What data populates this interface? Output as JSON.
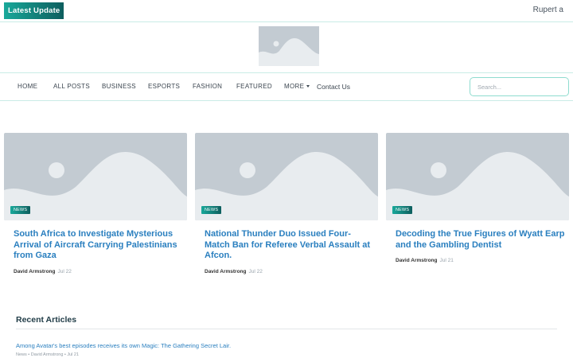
{
  "topbar": {
    "latest_label": "Latest  Update",
    "user_name": "Rupert a"
  },
  "nav": {
    "items": [
      "HOME",
      "ALL POSTS",
      "BUSINESS",
      "ESPORTS",
      "FASHION",
      "FEATURED",
      "MORE"
    ],
    "contact": "Contact Us",
    "search_placeholder": "Search..."
  },
  "cards": [
    {
      "badge": "NEWS",
      "title": "South Africa to Investigate Mysterious Arrival of Aircraft Carrying Palestinians from Gaza",
      "author": "David Armstrong",
      "date": "Jul 22"
    },
    {
      "badge": "NEWS",
      "title": "National Thunder Duo Issued Four-Match Ban for Referee Verbal Assault at Afcon.",
      "author": "David Armstrong",
      "date": "Jul 22"
    },
    {
      "badge": "NEWS",
      "title": "Decoding the True Figures of Wyatt Earp and the Gambling Dentist",
      "author": "David Armstrong",
      "date": "Jul 21"
    }
  ],
  "recent": {
    "title": "Recent Articles",
    "items": [
      {
        "title": "Among Avatar's best episodes receives its own Magic: The Gathering Secret Lair.",
        "meta": "News • David Armstrong • Jul 21"
      }
    ]
  },
  "colors": {
    "accent": "#19a89a",
    "accent_dark": "#0d5e5e",
    "link": "#2a7fbf",
    "placeholder_bg": "#c3cbd2",
    "border": "#c9ece6"
  }
}
